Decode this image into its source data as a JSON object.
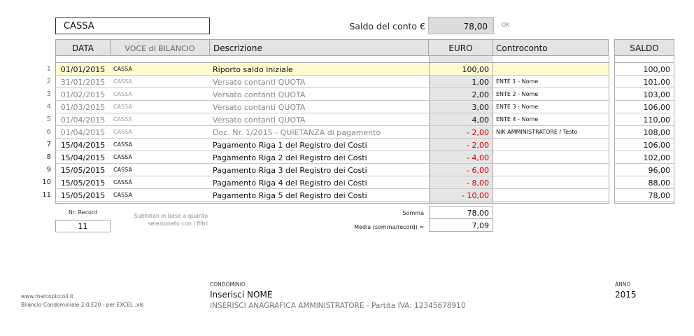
{
  "top": {
    "account_name": "CASSA",
    "saldo_label": "Saldo del conto €",
    "saldo_value": "78,00",
    "ok_label": "OK"
  },
  "headers": {
    "data": "DATA",
    "voce": "VOCE di BILANCIO",
    "descrizione": "Descrizione",
    "euro": "EURO",
    "controconto": "Controconto",
    "saldo": "SALDO"
  },
  "rows": [
    {
      "num": "1",
      "data": "01/01/2015",
      "voce": "CASSA",
      "descrizione": "Riporto saldo iniziale",
      "euro": "100,00",
      "controconto": "",
      "saldo": "100,00",
      "style": "first",
      "negative": false
    },
    {
      "num": "2",
      "data": "31/01/2015",
      "voce": "CASSA",
      "descrizione": "Versato contanti QUOTA",
      "euro": "1,00",
      "controconto": "ENTE 1 - Nome",
      "saldo": "101,00",
      "style": "gray",
      "negative": false
    },
    {
      "num": "3",
      "data": "01/02/2015",
      "voce": "CASSA",
      "descrizione": "Versato contanti QUOTA",
      "euro": "2,00",
      "controconto": "ENTE 2 - Nome",
      "saldo": "103,00",
      "style": "gray",
      "negative": false
    },
    {
      "num": "4",
      "data": "01/03/2015",
      "voce": "CASSA",
      "descrizione": "Versato contanti QUOTA",
      "euro": "3,00",
      "controconto": "ENTE 3 - Nome",
      "saldo": "106,00",
      "style": "gray",
      "negative": false
    },
    {
      "num": "5",
      "data": "01/04/2015",
      "voce": "CASSA",
      "descrizione": "Versato contanti QUOTA",
      "euro": "4,00",
      "controconto": "ENTE 4 - Nome",
      "saldo": "110,00",
      "style": "gray",
      "negative": false
    },
    {
      "num": "6",
      "data": "01/04/2015",
      "voce": "CASSA",
      "descrizione": "Doc. Nr. 1/2015 - QUIETANZA di pagamento",
      "euro": "- 2,00",
      "controconto": "NIK AMMINISTRATORE / Testo",
      "saldo": "108,00",
      "style": "gray",
      "negative": true
    },
    {
      "num": "7",
      "data": "15/04/2015",
      "voce": "CASSA",
      "descrizione": "Pagamento Riga 1 del Registro dei Costi",
      "euro": "- 2,00",
      "controconto": "",
      "saldo": "106,00",
      "style": "normal",
      "negative": true
    },
    {
      "num": "8",
      "data": "15/04/2015",
      "voce": "CASSA",
      "descrizione": "Pagamento Riga 2 del Registro dei Costi",
      "euro": "- 4,00",
      "controconto": "",
      "saldo": "102,00",
      "style": "normal",
      "negative": true
    },
    {
      "num": "9",
      "data": "15/05/2015",
      "voce": "CASSA",
      "descrizione": "Pagamento Riga 3 del Registro dei Costi",
      "euro": "- 6,00",
      "controconto": "",
      "saldo": "96,00",
      "style": "normal",
      "negative": true
    },
    {
      "num": "10",
      "data": "15/05/2015",
      "voce": "CASSA",
      "descrizione": "Pagamento Riga 4 del Registro dei Costi",
      "euro": "- 8,00",
      "controconto": "",
      "saldo": "88,00",
      "style": "normal",
      "negative": true
    },
    {
      "num": "11",
      "data": "15/05/2015",
      "voce": "CASSA",
      "descrizione": "Pagamento Riga 5 del Registro dei Costi",
      "euro": "- 10,00",
      "controconto": "",
      "saldo": "78,00",
      "style": "normal",
      "negative": true
    }
  ],
  "summary": {
    "nr_record_label": "Nr. Record",
    "nr_record_value": "11",
    "subtotali_line1": "Subtotali in base a quanto",
    "subtotali_line2": "selezionato con i filtri",
    "somma_label": "Somma",
    "somma_value": "78,00",
    "media_label": "Media (somma/record) =",
    "media_value": "7,09"
  },
  "footer": {
    "url": "www.marcopiccoli.it",
    "version": "Bilancio Condominiale 2.0.E20 - per EXCEL .xls",
    "condominio_label": "CONDOMINIO",
    "condominio_name": "Inserisci NOME",
    "amministratore": "INSERISCI ANAGRAFICA AMMINISTRATORE - Partita IVA: 12345678910",
    "anno_label": "ANNO",
    "anno_value": "2015"
  },
  "colors": {
    "negative": "#d40000",
    "highlight_row": "#fffad0",
    "header_bg": "#e3e3e3",
    "euro_column_bg": "#e6e6e6",
    "account_border": "#1f2a6b"
  }
}
